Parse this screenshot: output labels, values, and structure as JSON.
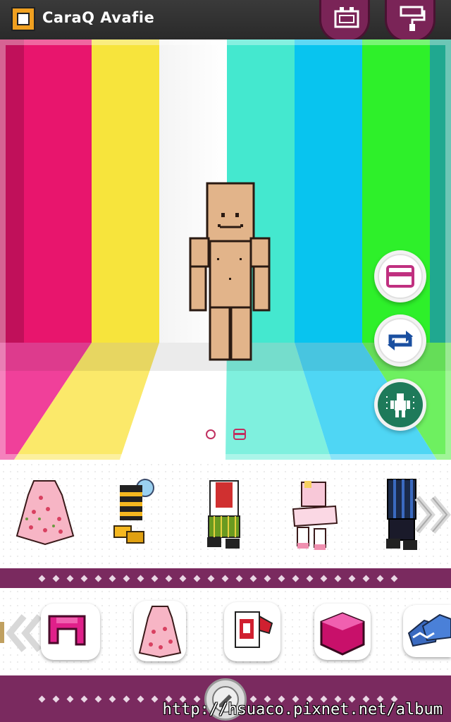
{
  "header": {
    "title": "CaraQ Avafie",
    "app_icon": "avatar-face-icon",
    "buttons": [
      {
        "name": "wardrobe-button",
        "icon": "wardrobe-icon"
      },
      {
        "name": "paint-roller-button",
        "icon": "paint-roller-icon"
      }
    ]
  },
  "stage": {
    "stripe_colors": [
      "#e8156d",
      "#f7e43c",
      "#ffffff",
      "#44e8cf",
      "#08c4ef",
      "#2ef02a"
    ],
    "side_buttons": [
      {
        "name": "outfit-card-button",
        "icon": "card-icon"
      },
      {
        "name": "rotate-button",
        "icon": "rotate-icon"
      },
      {
        "name": "dance-button",
        "icon": "figure-icon"
      }
    ],
    "pager": {
      "pages": 2,
      "current": 1
    }
  },
  "clothing_items": [
    {
      "name": "pink-floral-dress",
      "icon": "dress-icon"
    },
    {
      "name": "bee-costume",
      "icon": "bee-outfit-icon"
    },
    {
      "name": "green-striped-outfit",
      "icon": "striped-outfit-icon"
    },
    {
      "name": "pink-tutu-outfit",
      "icon": "tutu-outfit-icon"
    },
    {
      "name": "blue-jersey-outfit",
      "icon": "jersey-outfit-icon"
    }
  ],
  "category_items": [
    {
      "name": "category-furniture",
      "icon": "chair-icon"
    },
    {
      "name": "category-dress",
      "icon": "dress-icon"
    },
    {
      "name": "category-shirt",
      "icon": "shirt-icon"
    },
    {
      "name": "category-hat",
      "icon": "hat-icon"
    },
    {
      "name": "category-shoes",
      "icon": "shoes-icon"
    }
  ],
  "watermark": "http://hsuaco.pixnet.net/album"
}
